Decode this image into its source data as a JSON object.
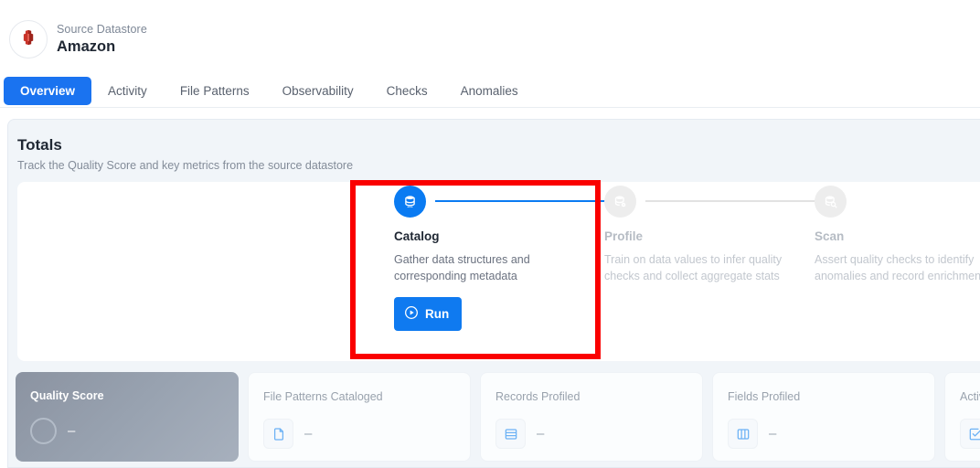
{
  "header": {
    "datastore_label": "Source Datastore",
    "datastore_name": "Amazon",
    "avatar_icon": "amazon-redshift-icon",
    "stray_dot_icon": "blue-circle-badge"
  },
  "tabs": [
    {
      "label": "Overview",
      "active": true,
      "name": "tab-overview"
    },
    {
      "label": "Activity",
      "active": false,
      "name": "tab-activity"
    },
    {
      "label": "File Patterns",
      "active": false,
      "name": "tab-file-patterns"
    },
    {
      "label": "Observability",
      "active": false,
      "name": "tab-observability"
    },
    {
      "label": "Checks",
      "active": false,
      "name": "tab-checks"
    },
    {
      "label": "Anomalies",
      "active": false,
      "name": "tab-anomalies"
    }
  ],
  "totals": {
    "title": "Totals",
    "subtitle": "Track the Quality Score and key metrics from the source datastore"
  },
  "stepper": {
    "steps": [
      {
        "name": "Catalog",
        "description": "Gather data structures and corresponding metadata",
        "state": "active",
        "icon": "database-stack-icon",
        "action_label": "Run",
        "action_icon": "play-circle-icon"
      },
      {
        "name": "Profile",
        "description": "Train on data values to infer quality checks and collect aggregate stats",
        "state": "inactive",
        "icon": "database-gear-icon"
      },
      {
        "name": "Scan",
        "description": "Assert quality checks to identify anomalies and record enrichment",
        "state": "inactive",
        "icon": "database-search-icon"
      }
    ]
  },
  "metrics": [
    {
      "title": "Quality Score",
      "value": "–",
      "icon": "score-ring-icon",
      "variant": "score"
    },
    {
      "title": "File Patterns Cataloged",
      "value": "–",
      "icon": "file-icon",
      "variant": "plain"
    },
    {
      "title": "Records Profiled",
      "value": "–",
      "icon": "records-table-icon",
      "variant": "plain"
    },
    {
      "title": "Fields Profiled",
      "value": "–",
      "icon": "columns-icon",
      "variant": "plain"
    },
    {
      "title": "Active",
      "value": "–",
      "icon": "check-square-icon",
      "variant": "plain"
    }
  ],
  "annotation": {
    "name": "highlight-box-catalog-step",
    "color": "#fa0000"
  },
  "colors": {
    "accent": "#0a7bf2",
    "panel_bg": "#f1f5f9",
    "muted_text": "#99a2ad"
  }
}
